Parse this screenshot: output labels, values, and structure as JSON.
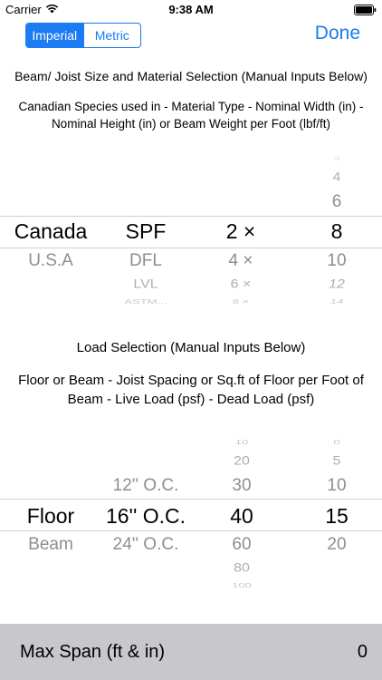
{
  "status": {
    "carrier": "Carrier",
    "time": "9:38 AM",
    "wifi_icon": "wifi-icon",
    "battery_icon": "battery-icon"
  },
  "toolbar": {
    "units": [
      "Imperial",
      "Metric"
    ],
    "selected_unit": "Imperial",
    "done_label": "Done",
    "accent_color": "#1a7bf2"
  },
  "section1": {
    "title": "Beam/ Joist Size and Material Selection (Manual Inputs Below)",
    "description": "Canadian Species used in - Material Type - Nominal Width (in) - Nominal Height (in) or Beam Weight per Foot (lbf/ft)"
  },
  "picker1": {
    "region": {
      "above": [],
      "selected": "Canada",
      "below": [
        "U.S.A"
      ]
    },
    "species": {
      "above": [],
      "selected": "SPF",
      "below": [
        "DFL",
        "LVL",
        "ASTM..."
      ]
    },
    "width": {
      "above": [],
      "selected": "2 ×",
      "below": [
        "4 ×",
        "6 ×",
        "8 ×"
      ]
    },
    "height": {
      "above": [
        "3",
        "4",
        "6"
      ],
      "selected": "8",
      "below": [
        "10",
        "12",
        "14"
      ]
    }
  },
  "section2": {
    "title": "Load Selection (Manual Inputs Below)",
    "description": "Floor or Beam - Joist Spacing or Sq.ft of Floor per Foot of Beam - Live Load (psf) - Dead Load (psf)"
  },
  "picker2": {
    "type": {
      "above": [],
      "selected": "Floor",
      "below": [
        "Beam"
      ]
    },
    "spacing": {
      "above": [
        "12'' O.C."
      ],
      "selected": "16'' O.C.",
      "below": [
        "24'' O.C."
      ]
    },
    "live_load": {
      "above": [
        "10",
        "20",
        "30"
      ],
      "selected": "40",
      "below": [
        "60",
        "80",
        "100"
      ]
    },
    "dead_load": {
      "above": [
        "0",
        "5",
        "10"
      ],
      "selected": "15",
      "below": [
        "20"
      ]
    }
  },
  "result": {
    "label": "Max Span (ft & in)",
    "value": "0"
  }
}
